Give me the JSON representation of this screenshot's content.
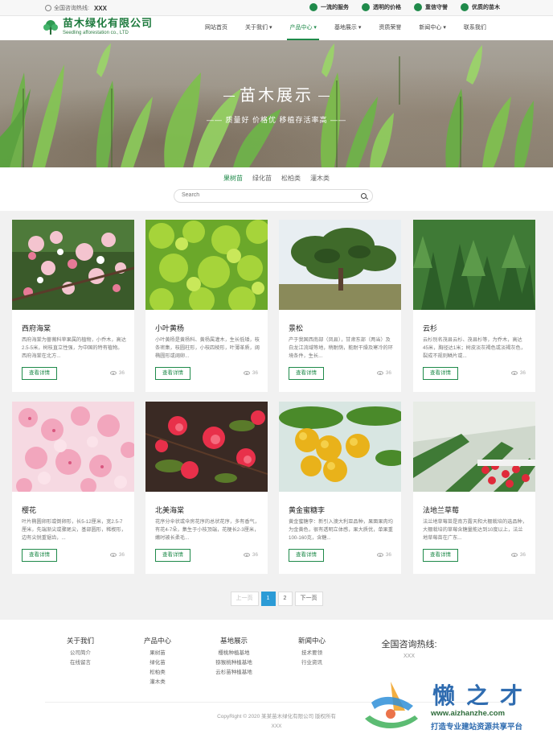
{
  "topbar": {
    "hotline_label": "全国咨询热线:",
    "hotline_number": "XXX",
    "services": [
      "一流的服务",
      "透明的价格",
      "重信守誉",
      "优质的苗木"
    ]
  },
  "logo": {
    "name_cn": "苗木绿化有限公司",
    "name_en": "Seedling afforestation co., LTD"
  },
  "nav": [
    "网站首页",
    "关于我们 ▾",
    "产品中心 ▾",
    "基地展示 ▾",
    "资质荣誉",
    "新闻中心 ▾",
    "联系我们"
  ],
  "banner": {
    "title": "苗木展示",
    "subtitle": "—— 质量好  价格优  移植存活率高 ——"
  },
  "categories": [
    "果树苗",
    "绿化苗",
    "松柏类",
    "灌木类"
  ],
  "search": {
    "placeholder": "Search"
  },
  "products": [
    {
      "name": "西府海棠",
      "desc": "西府海棠为蔷薇科苹果属的植物，小乔木，高达2.5-5米，树枝直立性强，为中国的特有植物。西府海棠在北方...",
      "button": "查看详情",
      "views": "36"
    },
    {
      "name": "小叶黄杨",
      "desc": "小叶黄杨是黄杨科、黄杨属灌木，生长低矮，枝条密集，枝圆柱形，小枝四棱形，叶薄革质，阔椭圆形或阔卵...",
      "button": "查看详情",
      "views": "36"
    },
    {
      "name": "景松",
      "desc": "产于我国西南部（凤县），甘肃东部（两当）及白龙江流域等地，稍耐荫，能耐干燥及寒冷的环境条件，生长...",
      "button": "查看详情",
      "views": "36"
    },
    {
      "name": "云杉",
      "desc": "云杉别名茂县云杉、茂县杉等，为乔木，高达45米，胸径达1米；树皮淡灰褐色或淡褐灰色，裂成不规则鳞片或...",
      "button": "查看详情",
      "views": "36"
    },
    {
      "name": "樱花",
      "desc": "叶片椭圆卵形或倒卵形，长5-12厘米，宽2.5-7厘米，先端渐尖或骤尾尖，基部圆形，稀楔形，边有尖锐重锯齿，...",
      "button": "查看详情",
      "views": "36"
    },
    {
      "name": "北美海棠",
      "desc": "花序分伞状或伞房花序的总状花序，多有香气，有花4-7朵，集生于小枝顶端，花梗长2-3厘米，嫩时被长柔毛...",
      "button": "查看详情",
      "views": "36"
    },
    {
      "name": "黄金蜜糖李",
      "desc": "黄金蜜糖李：新引入澳大利亚品种，果面果肉均为金黄色，很有透明立体感，果大质优，单果重100-160克，含糖...",
      "button": "查看详情",
      "views": "36"
    },
    {
      "name": "法地兰草莓",
      "desc": "法兰地草莓苗是南方露天和大棚栽培的选品种，大棚栽培的草莓含糖量能达到10度以上，法兰地草莓苗在广东...",
      "button": "查看详情",
      "views": "36"
    }
  ],
  "pagination": {
    "prev": "上一页",
    "pages": [
      "1",
      "2"
    ],
    "current": "1",
    "next": "下一页"
  },
  "footer": {
    "columns": [
      {
        "title": "关于我们",
        "links": [
          "公司简介",
          "在线留言"
        ]
      },
      {
        "title": "产品中心",
        "links": [
          "果树苗",
          "绿化苗",
          "松柏类",
          "灌木类"
        ]
      },
      {
        "title": "基地展示",
        "links": [
          "樱桃种植基地",
          "猕猴桃种植基地",
          "云杉苗种植基地"
        ]
      },
      {
        "title": "新闻中心",
        "links": [
          "技术要领",
          "行业资讯"
        ]
      }
    ],
    "hotline_title": "全国咨询热线:",
    "hotline_value": "XXX",
    "copyright": "CopyRight © 2020 某某苗木绿化有限公司 版权所有",
    "icp": "XXX"
  },
  "watermark": {
    "name": "懒之才",
    "url": "www.aizhanzhe.com",
    "tagline": "打造专业建站资源共享平台"
  },
  "colors": {
    "brand_green": "#1f8a4a",
    "page_active_blue": "#2c9bd6"
  }
}
